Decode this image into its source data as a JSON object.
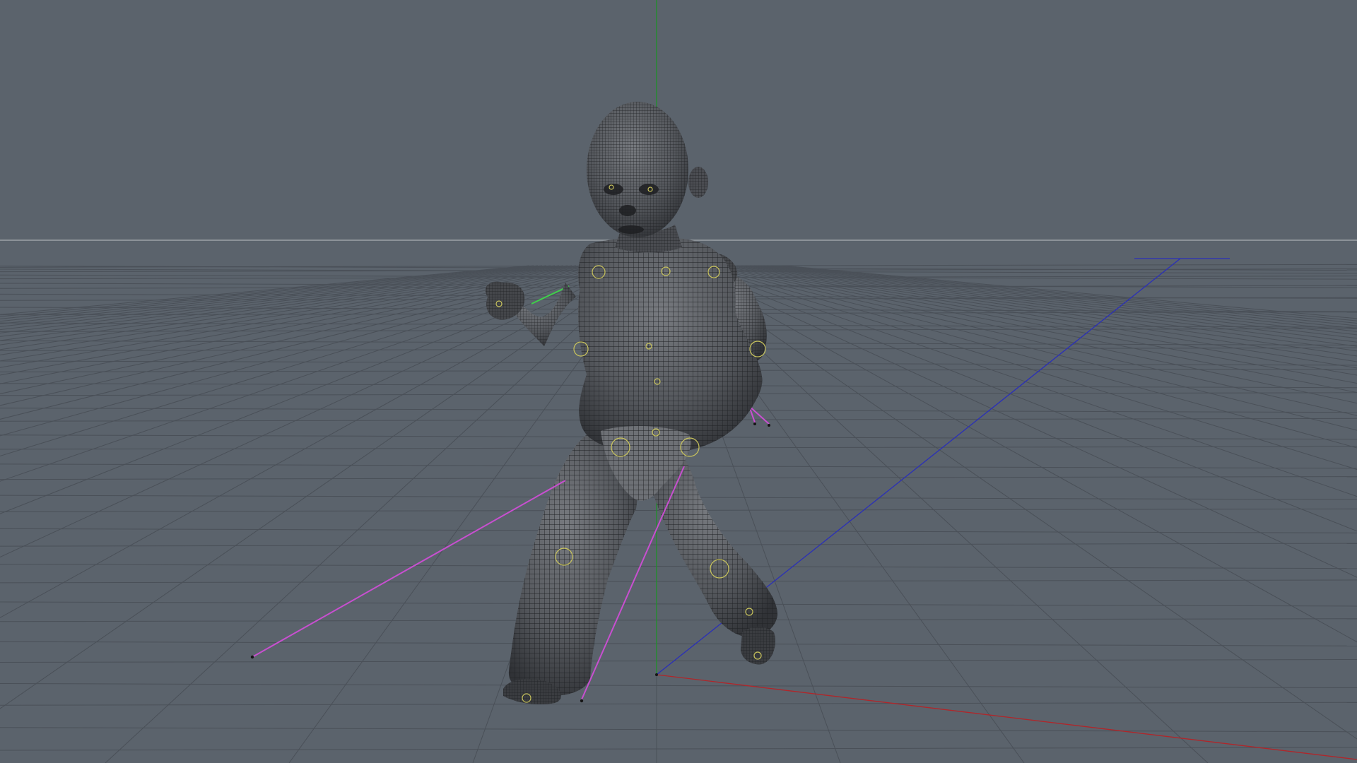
{
  "viewport": {
    "view": "perspective",
    "background_color": "#5b636c",
    "grid_color": "#4a5058",
    "horizon_color": "#a9aeb3",
    "axis_colors": {
      "x": "#b0262a",
      "y": "#1f8f2a",
      "z": "#2a2fb8"
    }
  },
  "scene": {
    "object": "baby-character-wireframe",
    "mesh_color": "#4c4e52",
    "wire_color": "#1f2124",
    "joint_color": "#c9c45c",
    "ik_handle_color": "#c84fd0",
    "joint_count": 18,
    "ik_handle_count": 4
  }
}
